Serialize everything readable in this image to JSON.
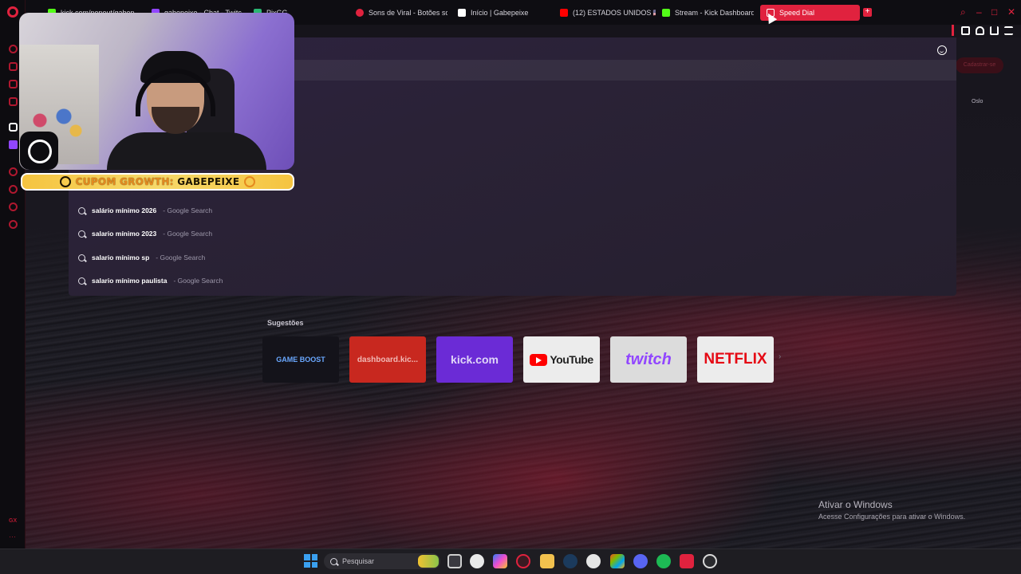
{
  "browser": {
    "tabs": [
      {
        "label": "kick.com/popout/gabep",
        "fav_color": "#53fc18"
      },
      {
        "label": "gabepeixe - Chat - Twitc",
        "fav_color": "#9146ff"
      },
      {
        "label": "PixGG",
        "fav_color": "#2bb673"
      },
      {
        "label": "Sons de Viral - Botões so",
        "fav_color": "#e0223e"
      },
      {
        "label": "Início | Gabepeixe",
        "fav_color": "#ffffff"
      },
      {
        "label": "(12) ESTADOS UNIDOS 🇺🇸",
        "fav_color": "#ff0000"
      },
      {
        "label": "Stream - Kick Dashboard",
        "fav_color": "#53fc18"
      },
      {
        "label": "Speed Dial",
        "fav_color": "#ffffff"
      }
    ],
    "new_tab_symbol": "+"
  },
  "dropdown": {
    "suggestions": [
      {
        "query": "salário mínimo 2026",
        "source": "- Google Search"
      },
      {
        "query": "salario mínimo 2023",
        "source": "- Google Search"
      },
      {
        "query": "salario mínimo sp",
        "source": "- Google Search"
      },
      {
        "query": "salario mínimo paulista",
        "source": "- Google Search"
      }
    ]
  },
  "background_page": {
    "button_label": "Cadastrar-se",
    "city": "Oslo"
  },
  "overlay": {
    "coupon_prefix": "CUPOM GROWTH:",
    "coupon_code": "GABEPEIXE"
  },
  "speed_dial": {
    "label": "Sugestões",
    "items": [
      {
        "label": "GAME BOOST",
        "bg": "#14131a",
        "color": "#6aa8ff"
      },
      {
        "label": "dashboard.kic...",
        "bg": "#c8281f",
        "color": "#f0b8b4"
      },
      {
        "label": "kick.com",
        "bg": "#6b2bd6",
        "color": "#e0d6f7"
      },
      {
        "label": "YouTube",
        "bg": "#ececec",
        "color": "#202020"
      },
      {
        "label": "twitch",
        "bg": "#dcdcdc",
        "color": "#9146ff"
      },
      {
        "label": "NETFLIX",
        "bg": "#ececec",
        "color": "#e50914"
      }
    ],
    "next_arrow": "›"
  },
  "watermark": {
    "title": "Ativar o Windows",
    "subtitle": "Acesse Configurações para ativar o Windows."
  },
  "taskbar": {
    "search_placeholder": "Pesquisar"
  }
}
